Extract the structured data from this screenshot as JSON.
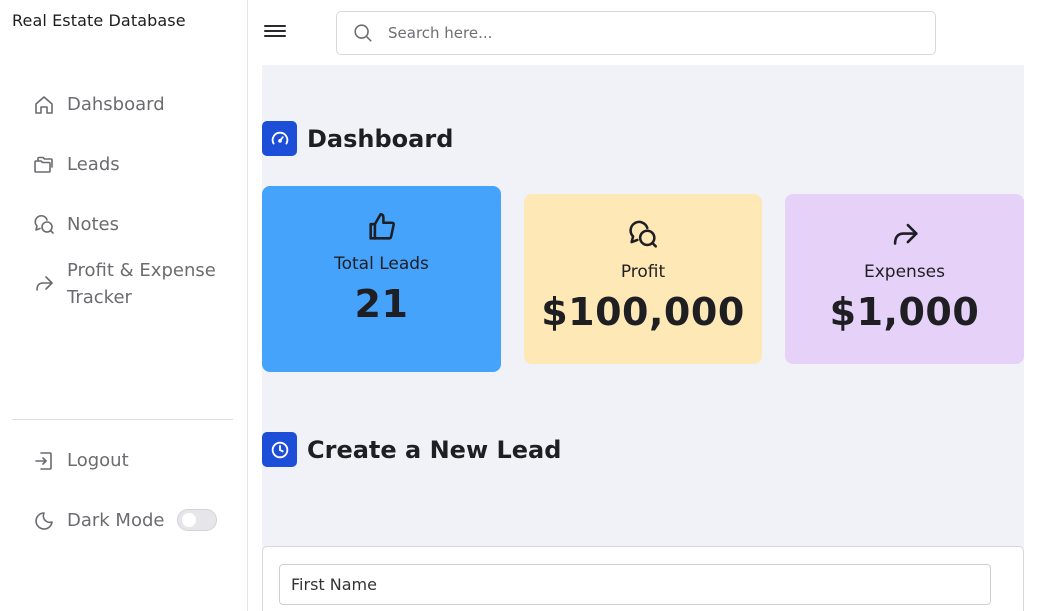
{
  "sidebar": {
    "brand": "Real Estate Database",
    "items": [
      {
        "label": "Dahsboard",
        "icon": "home-icon"
      },
      {
        "label": "Leads",
        "icon": "folders-icon"
      },
      {
        "label": "Notes",
        "icon": "chat-bubbles-icon"
      },
      {
        "label": "Profit & Expense Tracker",
        "icon": "share-arrow-icon"
      }
    ],
    "logout_label": "Logout",
    "dark_mode_label": "Dark Mode",
    "dark_mode_enabled": false
  },
  "search": {
    "placeholder": "Search here..."
  },
  "dashboard": {
    "title": "Dashboard",
    "cards": [
      {
        "label": "Total Leads",
        "value": "21",
        "color": "#46a3fb",
        "icon": "thumbs-up-icon"
      },
      {
        "label": "Profit",
        "value": "$100,000",
        "color": "#fde8b6",
        "icon": "chat-bubbles-icon"
      },
      {
        "label": "Expenses",
        "value": "$1,000",
        "color": "#e6d2f9",
        "icon": "share-arrow-icon"
      }
    ]
  },
  "create_lead": {
    "title": "Create a New Lead",
    "first_name_placeholder": "First Name"
  },
  "colors": {
    "accent": "#1d4ed8",
    "main_bg": "#f0f2f7"
  }
}
